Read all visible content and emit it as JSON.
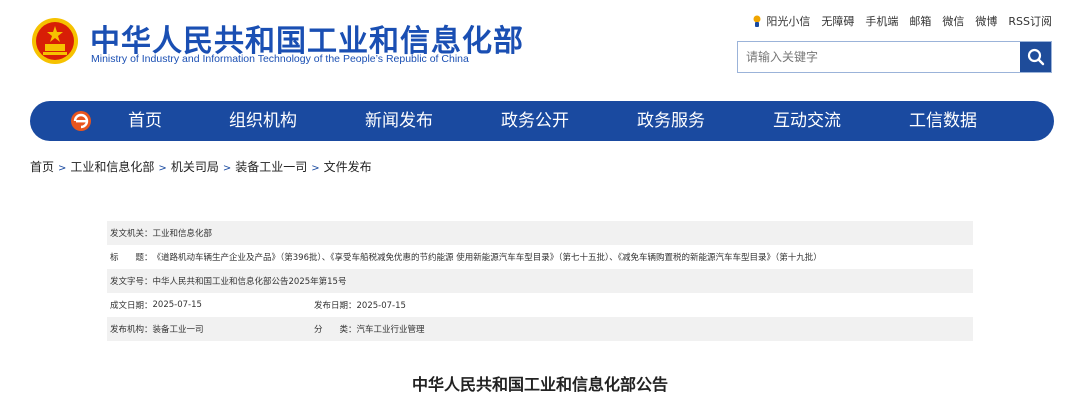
{
  "header": {
    "title": "中华人民共和国工业和信息化部",
    "subtitle": "Ministry of Industry and Information Technology of the People’s Republic of China",
    "emblem_icon": "national-emblem-icon"
  },
  "top_links": [
    "阳光小信",
    "无障碍",
    "手机端",
    "邮箱",
    "微信",
    "微博",
    "RSS订阅"
  ],
  "search": {
    "placeholder": "请输入关键字",
    "icon": "search-icon"
  },
  "nav": {
    "logo_icon": "miit-logo-icon",
    "items": [
      "首页",
      "组织机构",
      "新闻发布",
      "政务公开",
      "政务服务",
      "互动交流",
      "工信数据"
    ]
  },
  "breadcrumb": [
    "首页",
    "工业和信息化部",
    "机关司局",
    "装备工业一司",
    "文件发布"
  ],
  "info": {
    "issuer_label": "发文机关：",
    "issuer": "工业和信息化部",
    "title_label": "标　　题：",
    "title": "《道路机动车辆生产企业及产品》（第396批）、《享受车船税减免优惠的节约能源 使用新能源汽车车型目录》（第七十五批）、《减免车辆购置税的新能源汽车车型目录》（第十九批）",
    "doc_no_label": "发文字号：",
    "doc_no": "中华人民共和国工业和信息化部公告2025年第15号",
    "created_label": "成文日期：",
    "created": "2025-07-15",
    "published_label": "发布日期：",
    "published": "2025-07-15",
    "agency_label": "发布机构：",
    "agency": "装备工业一司",
    "category_label": "分　　类：",
    "category": "汽车工业行业管理"
  },
  "document_title": "中华人民共和国工业和信息化部公告",
  "colors": {
    "brand_blue": "#1a4aa0",
    "title_blue": "#1a4fb3",
    "emblem_red": "#d81e06",
    "emblem_gold": "#f6c200"
  }
}
